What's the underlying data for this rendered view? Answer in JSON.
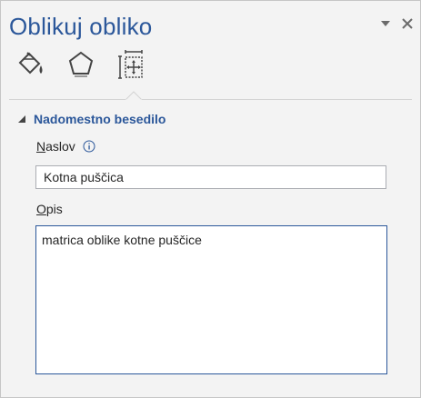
{
  "pane": {
    "title": "Oblikuj obliko",
    "menu_icon": "chevron-down-icon",
    "close_icon": "close-icon"
  },
  "tabs": [
    {
      "icon": "fill-line-icon"
    },
    {
      "icon": "effects-icon"
    },
    {
      "icon": "size-properties-icon",
      "selected": true
    }
  ],
  "section": {
    "title": "Nadomestno besedilo",
    "expanded": true
  },
  "fields": {
    "title_label_underlined": "N",
    "title_label_rest": "aslov",
    "title_value": "Kotna puščica",
    "description_label_underlined": "O",
    "description_label_rest": "pis",
    "description_value": "matrica oblike kotne puščice"
  },
  "colors": {
    "accent": "#2b579a",
    "background": "#f3f3f3",
    "text": "#262626"
  }
}
